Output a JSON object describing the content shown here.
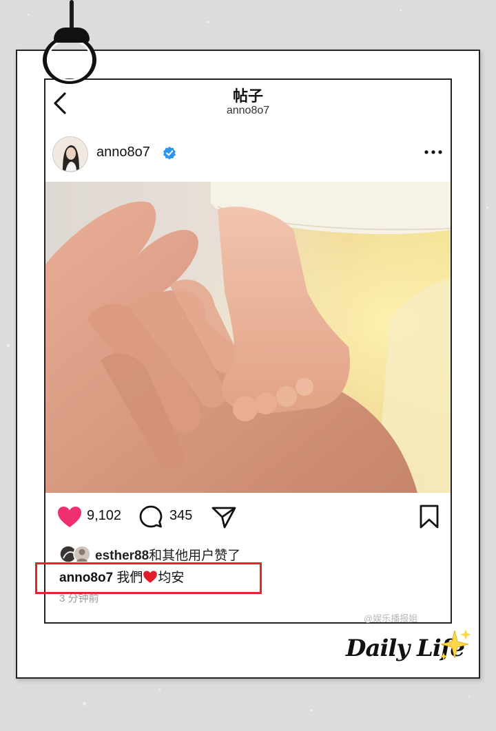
{
  "header": {
    "title": "帖子",
    "subtitle": "anno8o7"
  },
  "post": {
    "username": "anno8o7",
    "verified": true,
    "likes": "9,102",
    "comments": "345",
    "liked_by_user": "esther88",
    "liked_by_suffix": "和其他用户赞了",
    "caption_user": "anno8o7",
    "caption_text_before": "我們",
    "caption_text_after": "均安",
    "timestamp": "3 分钟前"
  },
  "overlay": {
    "decoration_text": "Daily Life",
    "watermark": "@娱乐播报姐"
  },
  "colors": {
    "like": "#f0306e",
    "verified": "#2b95f0",
    "highlight": "#e8202a"
  },
  "icons": [
    "back-icon",
    "verified-badge-icon",
    "more-icon",
    "heart-icon",
    "comment-icon",
    "share-icon",
    "bookmark-icon",
    "sparkle-icon"
  ]
}
